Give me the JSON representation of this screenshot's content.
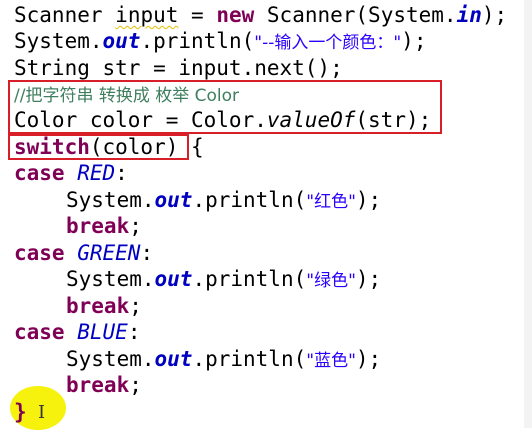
{
  "code": {
    "line1": {
      "type": "Scanner",
      "var": "input",
      "eq": " = ",
      "kw_new": "new",
      "ctor": " Scanner(System.",
      "field_in": "in",
      "end": ");"
    },
    "line2": {
      "pre": "System.",
      "field_out": "out",
      "call": ".println(",
      "str": "\"--输入一个颜色：\"",
      "end": ");"
    },
    "line3": {
      "text": "String str = input.next();"
    },
    "line4": {
      "comment": "//把字符串 转换成 枚举 Color"
    },
    "line5": {
      "pre": "Color color = Color.",
      "method": "valueOf",
      "end": "(str);"
    },
    "line6": {
      "kw": "switch",
      "arg": "(color)",
      "brace": " {"
    },
    "line7": {
      "kw": "case",
      "const": "RED",
      "colon": ":"
    },
    "line8": {
      "pre": "System.",
      "field_out": "out",
      "call": ".println(",
      "str": "\"红色\"",
      "end": ");"
    },
    "line9": {
      "kw": "break",
      "end": ";"
    },
    "line10": {
      "kw": "case",
      "const": "GREEN",
      "colon": ":"
    },
    "line11": {
      "pre": "System.",
      "field_out": "out",
      "call": ".println(",
      "str": "\"绿色\"",
      "end": ");"
    },
    "line12": {
      "kw": "break",
      "end": ";"
    },
    "line13": {
      "kw": "case",
      "const": "BLUE",
      "colon": ":"
    },
    "line14": {
      "pre": "System.",
      "field_out": "out",
      "call": ".println(",
      "str": "\"蓝色\"",
      "end": ");"
    },
    "line15": {
      "kw": "break",
      "end": ";"
    },
    "line16": {
      "brace": "}"
    }
  },
  "cursor_glyph": "I",
  "colors": {
    "keyword": "#7f0055",
    "field": "#0000c0",
    "string": "#2a00ff",
    "comment": "#3f7f5f",
    "highlight_box": "#d81e27",
    "cursor_highlight": "#f6f20e"
  }
}
